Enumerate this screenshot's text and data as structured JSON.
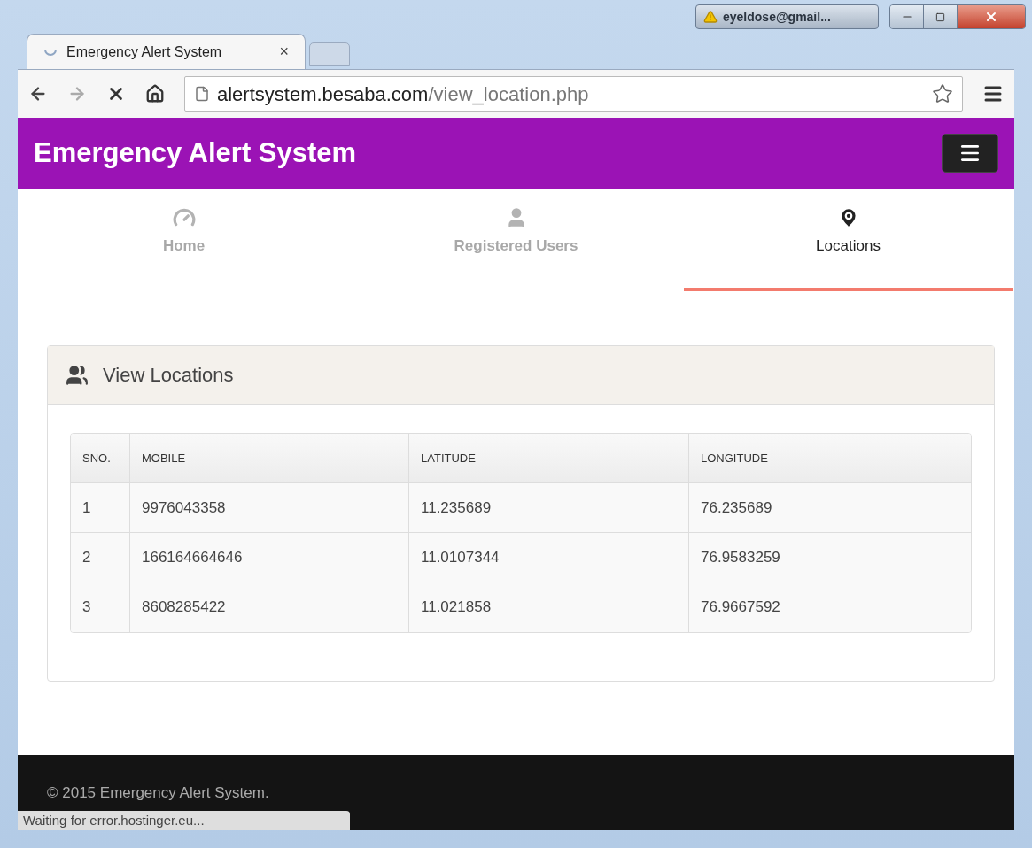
{
  "browser": {
    "account": "eyeldose@gmail...",
    "tab_title": "Emergency Alert System",
    "tab_close": "×",
    "url_host": "alertsystem.besaba.com",
    "url_path": "/view_location.php",
    "status": "Waiting for error.hostinger.eu..."
  },
  "header": {
    "title": "Emergency Alert System"
  },
  "nav": [
    {
      "label": "Home",
      "selected": false
    },
    {
      "label": "Registered Users",
      "selected": false
    },
    {
      "label": "Locations",
      "selected": true
    }
  ],
  "panel": {
    "title": "View Locations"
  },
  "table": {
    "columns": [
      "SNO.",
      "MOBILE",
      "LATITUDE",
      "LONGITUDE"
    ],
    "rows": [
      [
        "1",
        "9976043358",
        "11.235689",
        "76.235689"
      ],
      [
        "2",
        "166164664646",
        "11.0107344",
        "76.9583259"
      ],
      [
        "3",
        "8608285422",
        "11.021858",
        "76.9667592"
      ]
    ]
  },
  "footer": {
    "text": "© 2015 Emergency Alert System."
  }
}
